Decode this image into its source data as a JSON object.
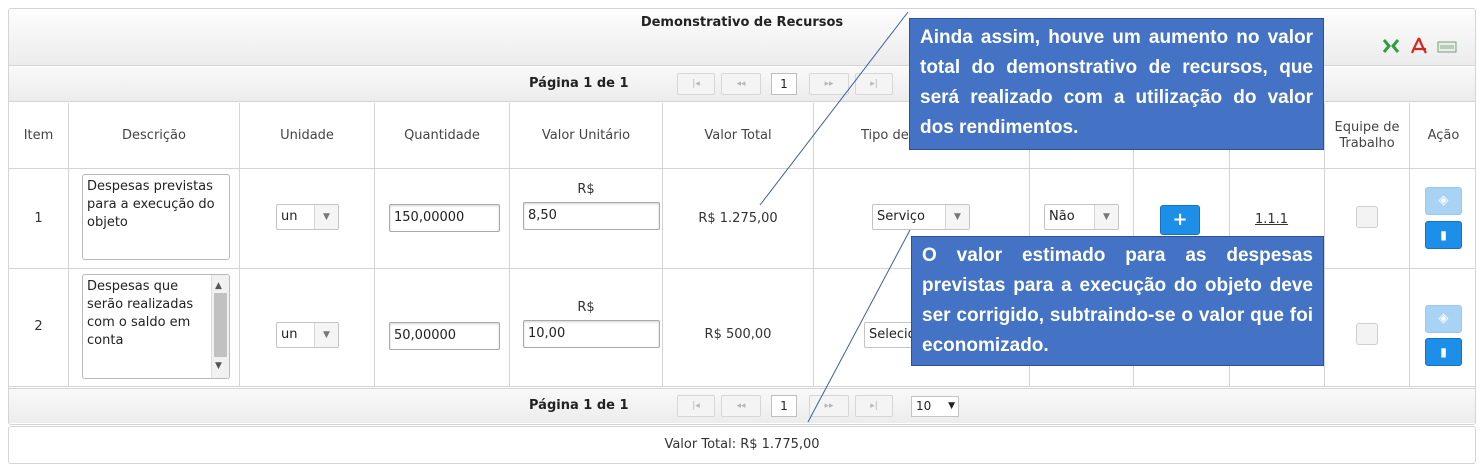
{
  "panel": {
    "title": "Demonstrativo de Recursos",
    "export_icons": [
      "excel-export-icon",
      "pdf-export-icon",
      "csv-export-icon"
    ]
  },
  "pager_top": {
    "page_info": "Página 1 de 1",
    "first": "|◂",
    "prev": "◂◂",
    "current": "1",
    "next": "▸▸",
    "last": "▸|"
  },
  "pager_bottom": {
    "page_info": "Página 1 de 1",
    "first": "|◂",
    "prev": "◂◂",
    "current": "1",
    "next": "▸▸",
    "last": "▸|",
    "rows_per_page": "10"
  },
  "columns": {
    "item": "Item",
    "descricao": "Descrição",
    "unidade": "Unidade",
    "quantidade": "Quantidade",
    "valor_unitario": "Valor Unitário",
    "valor_total": "Valor Total",
    "tipo": "Tipo de",
    "equipe": "Equipe de Trabalho",
    "acao": "Ação"
  },
  "rows": [
    {
      "item": "1",
      "descricao": "Despesas previstas para a execução do objeto",
      "unidade": "un",
      "quantidade": "150,00000",
      "currency": "R$",
      "valor_unitario": "8,50",
      "valor_total": "R$ 1.275,00",
      "tipo": "Serviço",
      "despesa": "Não",
      "meta": "1.1.1"
    },
    {
      "item": "2",
      "descricao": "Despesas que serão realizadas com o saldo em conta",
      "unidade": "un",
      "quantidade": "50,00000",
      "currency": "R$",
      "valor_unitario": "10,00",
      "valor_total": "R$ 500,00",
      "tipo": "Selecio"
    }
  ],
  "footer": {
    "total": "Valor Total: R$ 1.775,00"
  },
  "callouts": {
    "top": "Ainda assim, houve um aumento no valor total do demonstrativo de recursos, que será realizado com a utilização do valor dos rendimentos.",
    "bottom": "O valor estimado para as despesas previstas para a execução do objeto deve ser corrigido, subtraindo-se o valor que foi economizado."
  },
  "colors": {
    "callout_bg": "#4472c4",
    "primary_button": "#1e8fe8",
    "disabled_button": "#a9d3f5"
  }
}
